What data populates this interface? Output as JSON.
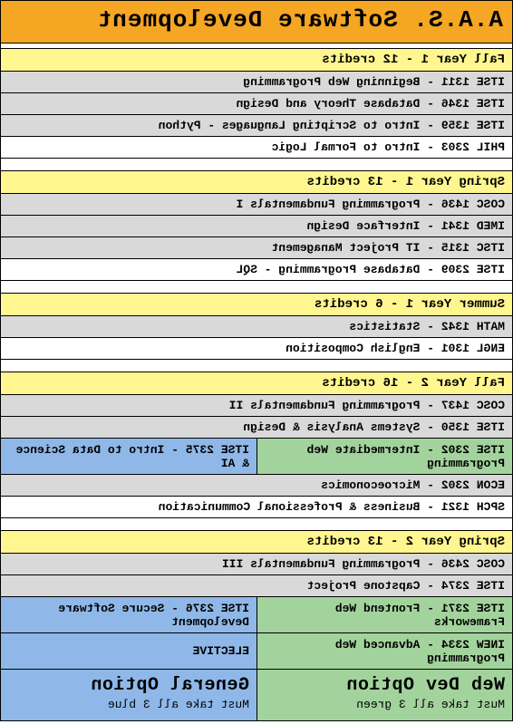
{
  "title": "A.A.S. Software Development",
  "semesters": [
    {
      "header": "Fall Year 1 - 12 credits",
      "rows": [
        "ITSE 1311 - Beginning Web Programming",
        "ITSE 1346 - Database Theory and Design",
        "ITSE 1359 - Intro to Scripting Languages - Python"
      ],
      "extra_white": "PHIL 2303 - Intro to Formal Logic"
    },
    {
      "header": "Spring Year 1 - 13 credits",
      "rows": [
        "COSC 1436 - Programming Fundamentals I",
        "IMED 1341 - Interface Design",
        "ITSC 1315 - IT Project Management"
      ],
      "extra_white": "ITSE 2309 - Database Programming - SQL"
    },
    {
      "header": "Summer Year 1 - 6 credits",
      "rows": [
        "MATH 1342 - Statistics"
      ],
      "extra_white": "ENGL 1301 - English Composition"
    }
  ],
  "fall2": {
    "header": "Fall Year 2 - 16 credits",
    "rows": [
      "COSC 1437 - Programming Fundamentals II",
      "ITSE 1350 - Systems Analysis & Design"
    ],
    "split_left": "ITSE 2302 - Intermediate Web Programming",
    "split_right": "ITSE 2375 - Intro to Data Science & AI",
    "tail": [
      "ECON 2302 - Microeconomics",
      "SPCH 1321 - Business & Professional Communication"
    ]
  },
  "spring2": {
    "header": "Spring Year 2 - 13 credits",
    "rows": [
      "COSC 2436 - Programming Fundamentals III",
      "ITSE 2374 - Capstone Project"
    ],
    "split1_left": "ITSE 2371 - Frontend Web Frameworks",
    "split1_right": "ITSE 2376 - Secure Software Development",
    "split2_left": "INEW 2334 - Advanced Web Programming",
    "split2_right": "ELECTIVE"
  },
  "options": {
    "left_title": "Web Dev Option",
    "left_sub": "Must take all 3 green",
    "right_title": "General Option",
    "right_sub": "Must take all 3 blue"
  }
}
